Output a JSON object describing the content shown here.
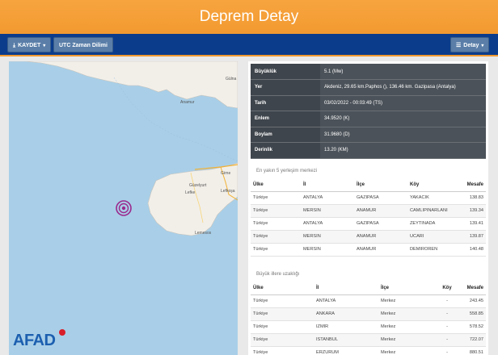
{
  "header": {
    "title": "Deprem Detay"
  },
  "toolbar": {
    "save_label": "KAYDET",
    "utc_label": "UTC Zaman Dilimi",
    "detail_label": "Detay"
  },
  "map": {
    "places": [
      "Gülna",
      "Anamur",
      "Girne",
      "Lefke",
      "Güzelyurt",
      "Lefkoşa",
      "Lemesos"
    ],
    "logo": "AFAD"
  },
  "info": [
    {
      "key": "Büyüklük",
      "value": "5.1 (Mw)"
    },
    {
      "key": "Yer",
      "value": "Akdeniz, 29.65 km.Paphos (), 136.46 km. Gazipasa (Antalya)"
    },
    {
      "key": "Tarih",
      "value": "03/02/2022 - 00:03:49 (TS)"
    },
    {
      "key": "Enlem",
      "value": "34.9520 (K)"
    },
    {
      "key": "Boylam",
      "value": "31.9680 (D)"
    },
    {
      "key": "Derinlik",
      "value": "13.20 (KM)"
    }
  ],
  "nearest": {
    "title": "En yakın 5 yerleşim merkezi",
    "headers": [
      "Ülke",
      "İl",
      "İlçe",
      "Köy",
      "Mesafe"
    ],
    "rows": [
      [
        "Türkiye",
        "ANTALYA",
        "GAZIPASA",
        "YAKACIK",
        "138.83"
      ],
      [
        "Türkiye",
        "MERSIN",
        "ANAMUR",
        "CAMLIPINARLANI",
        "139.34"
      ],
      [
        "Türkiye",
        "ANTALYA",
        "GAZIPASA",
        "ZEYTINADA",
        "139.41"
      ],
      [
        "Türkiye",
        "MERSIN",
        "ANAMUR",
        "UCARI",
        "139.87"
      ],
      [
        "Türkiye",
        "MERSIN",
        "ANAMUR",
        "DEMIROREN",
        "140.48"
      ]
    ]
  },
  "cities": {
    "title": "Büyük illere uzaklığı",
    "headers": [
      "Ülke",
      "İl",
      "İlçe",
      "Köy",
      "Mesafe"
    ],
    "rows": [
      [
        "Türkiye",
        "ANTALYA",
        "Merkez",
        "-",
        "243.45"
      ],
      [
        "Türkiye",
        "ANKARA",
        "Merkez",
        "-",
        "558.85"
      ],
      [
        "Türkiye",
        "IZMIR",
        "Merkez",
        "-",
        "578.52"
      ],
      [
        "Türkiye",
        "ISTANBUL",
        "Merkez",
        "-",
        "722.07"
      ],
      [
        "Türkiye",
        "ERZURUM",
        "Merkez",
        "-",
        "880.51"
      ]
    ]
  }
}
